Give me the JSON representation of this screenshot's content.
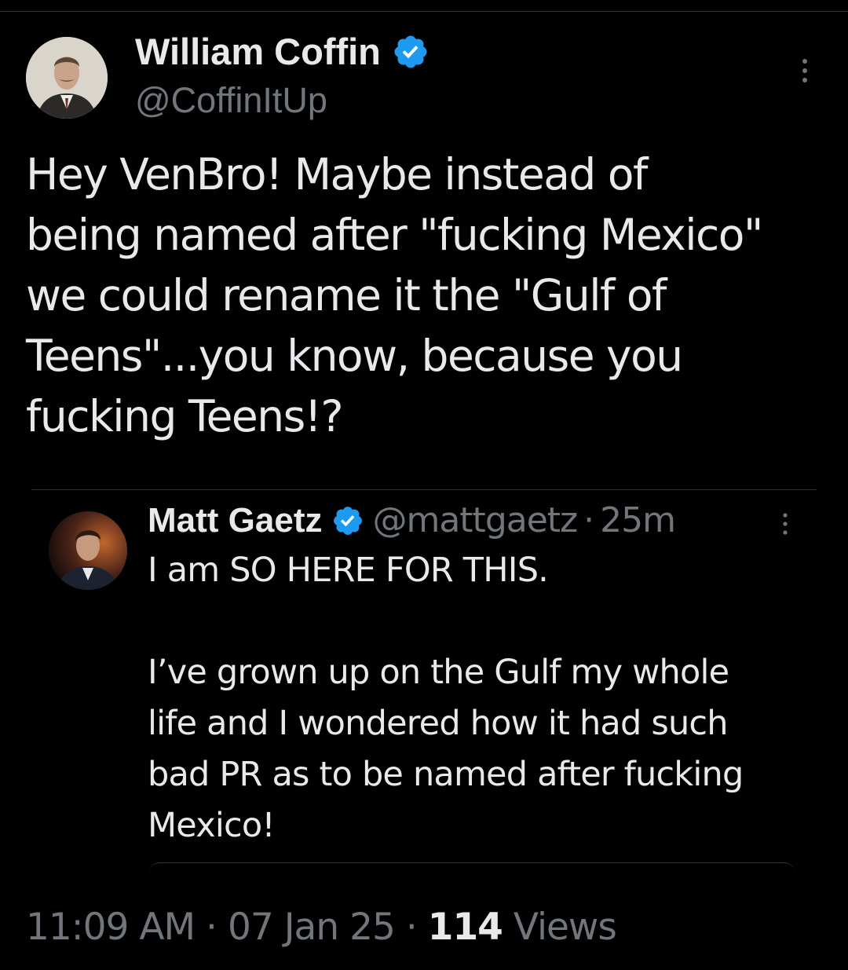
{
  "tweet": {
    "author_name": "William Coffin",
    "author_handle": "@CoffinItUp",
    "verified_badge_icon": "verified-badge-icon",
    "text": "Hey VenBro! Maybe instead of\nbeing named after \"fucking Mexico\"\nwe could  rename it the \"Gulf of\nTeens\"...you know, because you\nfucking Teens!?",
    "time": "11:09 AM",
    "date": "07 Jan 25",
    "separator": "·",
    "views_count": "114",
    "views_label": "Views"
  },
  "reply": {
    "author_name": "Matt Gaetz",
    "author_handle": "@mattgaetz",
    "separator": "·",
    "time_ago": "25m",
    "text": "I am SO HERE FOR THIS.\n\nI’ve grown up on the Gulf my whole\nlife and I wondered how it had such\nbad PR as to be named after fucking\nMexico!"
  },
  "icons": {
    "more": "more-vertical-icon",
    "verified": "verified-badge-icon",
    "badge_color": "#1d9bf0"
  }
}
